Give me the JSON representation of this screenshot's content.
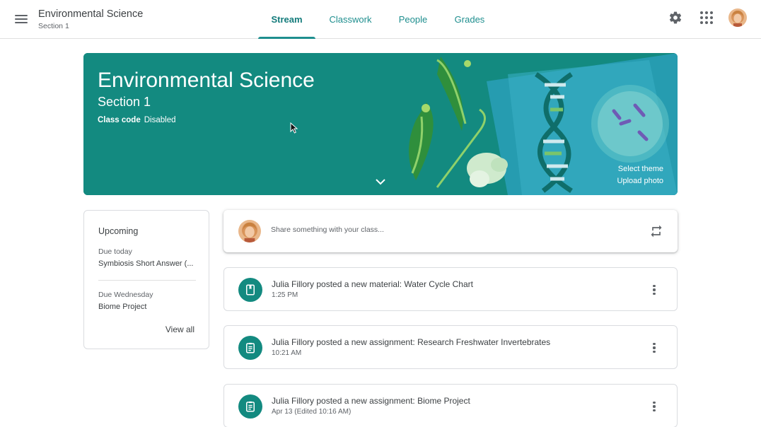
{
  "header": {
    "title": "Environmental Science",
    "subtitle": "Section 1",
    "tabs": [
      {
        "label": "Stream",
        "active": true
      },
      {
        "label": "Classwork",
        "active": false
      },
      {
        "label": "People",
        "active": false
      },
      {
        "label": "Grades",
        "active": false
      }
    ],
    "icons": [
      "menu-icon",
      "gear-icon",
      "apps-grid-icon",
      "avatar"
    ]
  },
  "banner": {
    "title": "Environmental Science",
    "section": "Section 1",
    "class_code_label": "Class code",
    "class_code_value": "Disabled",
    "select_theme": "Select theme",
    "upload_photo": "Upload photo",
    "color": "#138a80"
  },
  "upcoming": {
    "title": "Upcoming",
    "items": [
      {
        "due": "Due today",
        "name": "Symbiosis Short Answer (..."
      },
      {
        "due": "Due Wednesday",
        "name": "Biome Project"
      }
    ],
    "view_all": "View all"
  },
  "share": {
    "placeholder": "Share something with your class..."
  },
  "posts": [
    {
      "icon": "material-icon",
      "title": "Julia Fillory posted a new material: Water Cycle Chart",
      "time": "1:25 PM"
    },
    {
      "icon": "assignment-icon",
      "title": "Julia Fillory posted a new assignment: Research Freshwater Invertebrates",
      "time": "10:21 AM"
    },
    {
      "icon": "assignment-icon",
      "title": "Julia Fillory posted a new assignment: Biome Project",
      "time": "Apr 13 (Edited 10:16 AM)"
    }
  ],
  "colors": {
    "accent": "#1e8e8e",
    "banner": "#138a80",
    "text": "#3c4043",
    "muted": "#5f6368"
  }
}
